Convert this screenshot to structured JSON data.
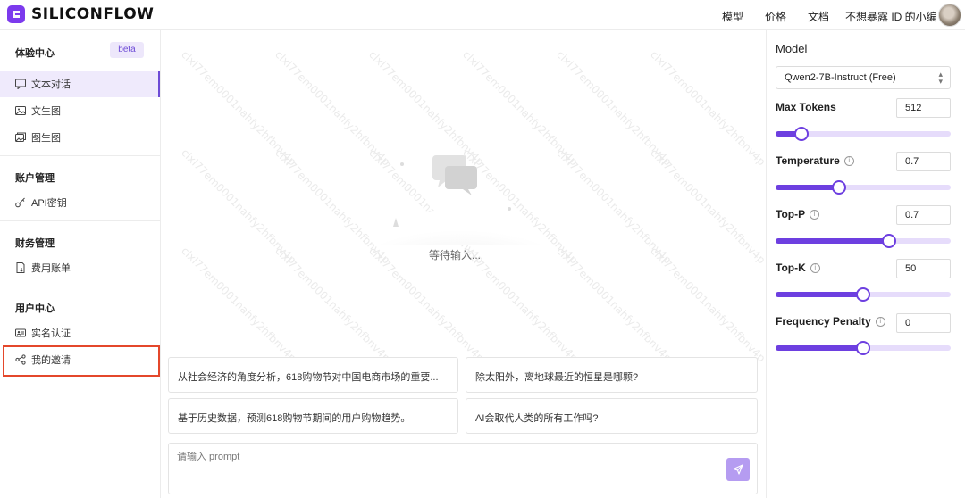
{
  "header": {
    "brand": "SILICONFLOW",
    "nav": [
      "模型",
      "价格",
      "文档"
    ],
    "user_name": "不想暴露 ID 的小编"
  },
  "sidebar": {
    "sections": [
      {
        "title": "体验中心",
        "badge": "beta",
        "items": [
          {
            "label": "文本对话",
            "icon": "chat-icon",
            "active": true
          },
          {
            "label": "文生图",
            "icon": "image-icon"
          },
          {
            "label": "图生图",
            "icon": "images-icon"
          }
        ]
      },
      {
        "title": "账户管理",
        "items": [
          {
            "label": "API密钥",
            "icon": "key-icon"
          }
        ]
      },
      {
        "title": "财务管理",
        "items": [
          {
            "label": "费用账单",
            "icon": "bill-icon"
          }
        ]
      },
      {
        "title": "用户中心",
        "items": [
          {
            "label": "实名认证",
            "icon": "id-card-icon"
          },
          {
            "label": "我的邀请",
            "icon": "share-icon",
            "highlighted": true
          }
        ]
      }
    ]
  },
  "main": {
    "watermark": "clxl77em0001nahfy2hfbnv4p",
    "empty_text": "等待输入...",
    "suggestions": [
      "从社会经济的角度分析，618购物节对中国电商市场的重要...",
      "除太阳外，离地球最近的恒星是哪颗?",
      "基于历史数据，预测618购物节期间的用户购物趋势。",
      "AI会取代人类的所有工作吗?"
    ],
    "prompt_placeholder": "请输入 prompt"
  },
  "settings": {
    "model_label": "Model",
    "model_value": "Qwen2-7B-Instruct (Free)",
    "params": [
      {
        "label": "Max Tokens",
        "value": "512",
        "info": false,
        "level": 0.15
      },
      {
        "label": "Temperature",
        "value": "0.7",
        "info": true,
        "level": 0.36
      },
      {
        "label": "Top-P",
        "value": "0.7",
        "info": true,
        "level": 0.65
      },
      {
        "label": "Top-K",
        "value": "50",
        "info": true,
        "level": 0.5
      },
      {
        "label": "Frequency Penalty",
        "value": "0",
        "info": true,
        "level": 0.5
      }
    ]
  },
  "colors": {
    "accent": "#6d3fe0",
    "active_bg": "#efeafc",
    "highlight": "#e4472b"
  }
}
